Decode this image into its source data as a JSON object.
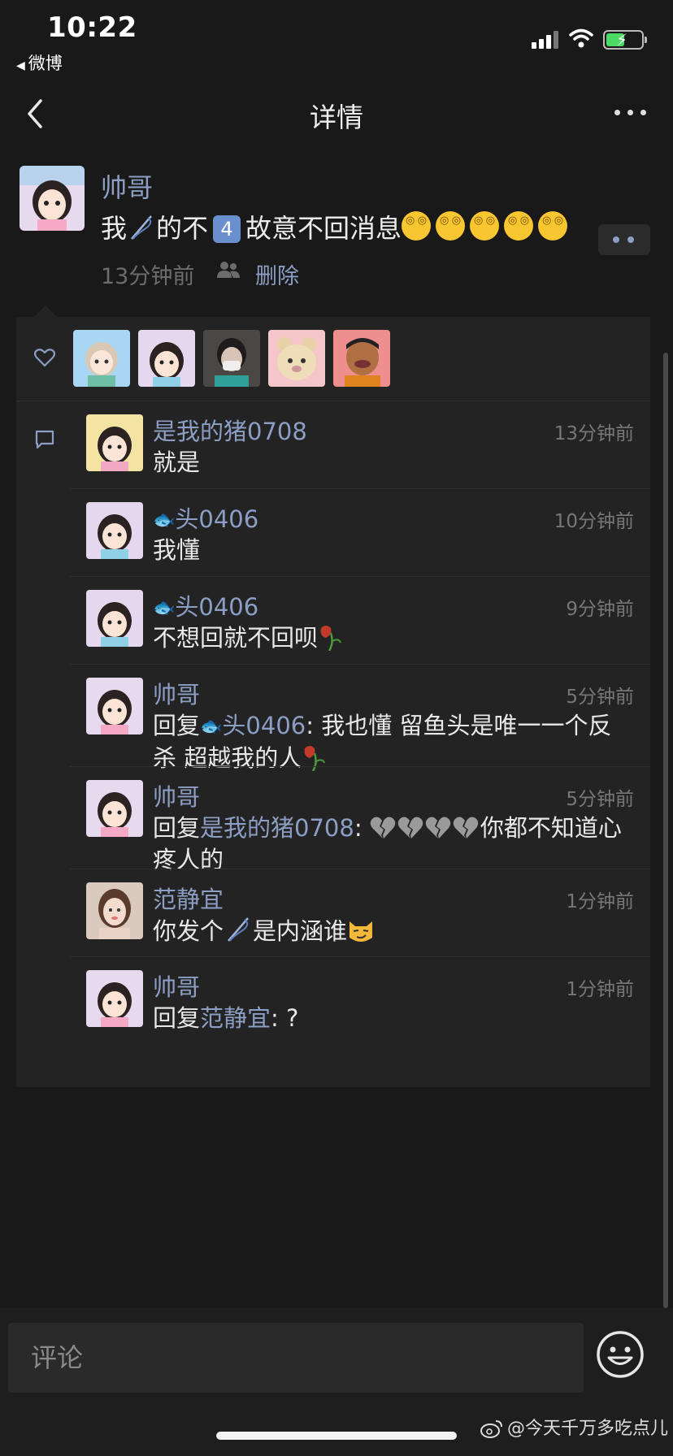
{
  "status_bar": {
    "time": "10:22",
    "back_app": "微博"
  },
  "nav": {
    "title": "详情"
  },
  "post": {
    "author": "帅哥",
    "text_parts": [
      "我",
      "的不",
      "4",
      "故意不回消息"
    ],
    "emoji_count": 5,
    "time": "13分钟前",
    "delete_label": "删除"
  },
  "likes": {
    "avatars": [
      "avatar-girl-blonde",
      "avatar-girl-dark",
      "avatar-boy-mask",
      "avatar-bear",
      "avatar-cartoon-man"
    ]
  },
  "comments": [
    {
      "name": "是我的猪0708",
      "time": "13分钟前",
      "text": "就是"
    },
    {
      "name_fish": "🐟",
      "name": "头0406",
      "time": "10分钟前",
      "text": "我懂"
    },
    {
      "name_fish": "🐟",
      "name": "头0406",
      "time": "9分钟前",
      "text": "不想回就不回呗"
    },
    {
      "name": "帅哥",
      "time": "5分钟前",
      "reply_prefix": "回复",
      "reply_fish": "🐟",
      "reply_to": "头0406",
      "text_line1": "我也懂 留鱼头是唯一一个反",
      "text_line2": "杀 超越我的人"
    },
    {
      "name": "帅哥",
      "time": "5分钟前",
      "reply_prefix": "回复",
      "reply_to": "是我的猪0708",
      "text_line1": "你都不知道心",
      "text_line2": "疼人的"
    },
    {
      "name": "范静宜",
      "time": "1分钟前",
      "text_a": "你发个",
      "text_b": "是内涵谁"
    },
    {
      "name": "帅哥",
      "time": "1分钟前",
      "reply_prefix": "回复",
      "reply_to": "范静宜",
      "text": "?"
    }
  ],
  "input": {
    "placeholder": "评论"
  },
  "watermark": "@今天千万多吃点儿",
  "colors": {
    "link": "#8c9ec4",
    "background": "#191919",
    "panel": "#232323"
  }
}
